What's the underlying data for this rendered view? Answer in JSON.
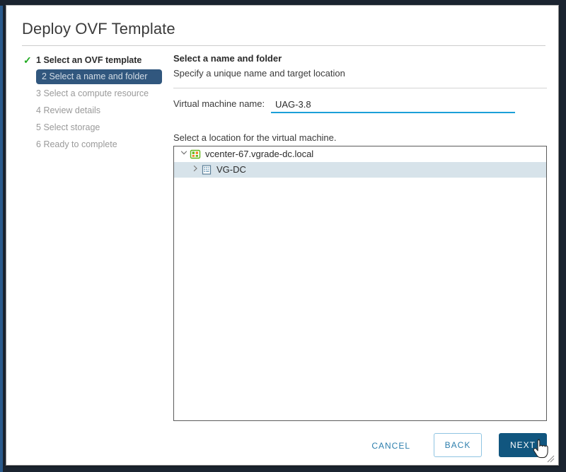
{
  "window": {
    "title": "Deploy OVF Template"
  },
  "steps": [
    {
      "number": "1",
      "label": "Select an OVF template",
      "state": "done",
      "icon": "check-icon"
    },
    {
      "number": "2",
      "label": "Select a name and folder",
      "state": "current"
    },
    {
      "number": "3",
      "label": "Select a compute resource",
      "state": "pending"
    },
    {
      "number": "4",
      "label": "Review details",
      "state": "pending"
    },
    {
      "number": "5",
      "label": "Select storage",
      "state": "pending"
    },
    {
      "number": "6",
      "label": "Ready to complete",
      "state": "pending"
    }
  ],
  "content": {
    "heading": "Select a name and folder",
    "subheading": "Specify a unique name and target location",
    "vm_name_label": "Virtual machine name:",
    "vm_name_value": "UAG-3.8",
    "vm_name_placeholder": "Enter a name",
    "location_label": "Select a location for the virtual machine."
  },
  "tree": {
    "nodes": [
      {
        "label": "vcenter-67.vgrade-dc.local",
        "icon": "vcenter-server-icon",
        "twisty": "chevron-down-icon",
        "expanded": true,
        "selected": false
      },
      {
        "label": "VG-DC",
        "icon": "datacenter-icon",
        "twisty": "chevron-right-icon",
        "expanded": false,
        "selected": true
      }
    ]
  },
  "footer": {
    "cancel_label": "CANCEL",
    "back_label": "BACK",
    "next_label": "NEXT"
  },
  "colors": {
    "active_step_bg": "#31577e",
    "next_button_bg": "#11567f",
    "link_blue": "#2e7fad",
    "input_underline": "#1b9fd8",
    "selected_row": "#d7e3ea",
    "check_green": "#1faa1f",
    "window_chrome": "#1b2430"
  }
}
